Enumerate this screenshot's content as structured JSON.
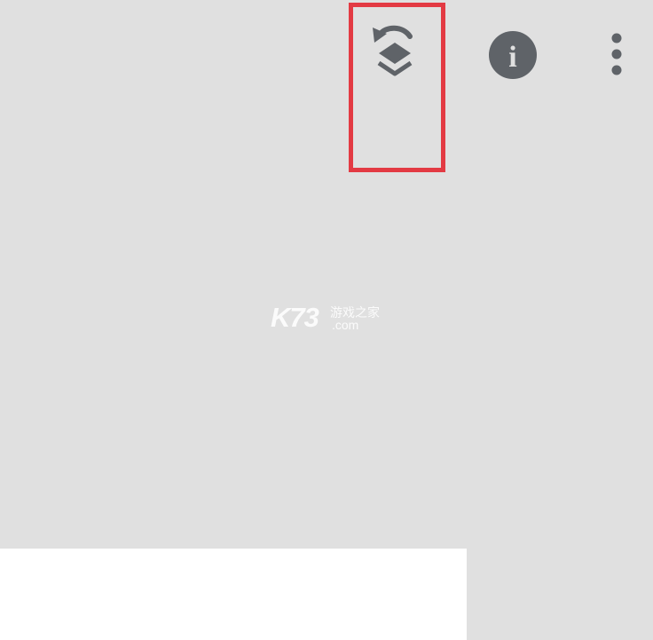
{
  "toolbar": {
    "buttons": [
      {
        "id": "undo-layers",
        "icon": "undo-layers-icon"
      },
      {
        "id": "info",
        "icon": "info-icon",
        "glyph": "i"
      },
      {
        "id": "more",
        "icon": "more-vert-icon"
      }
    ]
  },
  "highlight": {
    "color": "#e33a43"
  },
  "watermark": {
    "brand": "K73",
    "tagline": "游戏之家",
    "domain": ".com"
  },
  "colors": {
    "background": "#e0e0e0",
    "icon": "#5f6368",
    "highlight": "#e33a43",
    "panel": "#ffffff"
  }
}
